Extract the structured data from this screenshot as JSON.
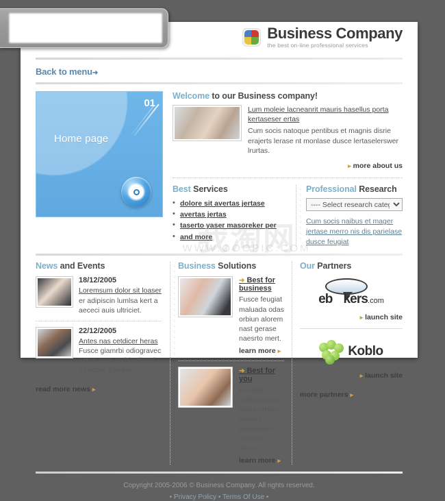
{
  "overlay": {
    "name": "blurred-panel"
  },
  "header": {
    "brand_name": "Business Company",
    "tagline": "the best on-line professional services",
    "back_label": "Back to menu",
    "back_arrow": "➜"
  },
  "hero": {
    "title": "Home page",
    "number": "01",
    "disc_icon": "target-disc-icon"
  },
  "welcome": {
    "title_hl": "Welcome",
    "title_rest": " to our Business company!",
    "thumb": "people-group-photo",
    "link": "Lum moleie lacneanrit mauris hasellus porta kertaseser ertas",
    "copy": "Cum socis natoque pentibus et magnis disrie erajerts lerase nt monlase dusce lertaselerswer lrurtas.",
    "more_label": "more about us",
    "bullet": "▸"
  },
  "services": {
    "title_hl": "Best",
    "title_rest": " Services",
    "items": [
      "dolore sit avertas jertase",
      "avertas jertas",
      "taserto yaser masoreker per",
      "and more"
    ]
  },
  "research": {
    "title_hl": "Professional",
    "title_rest": " Research",
    "select_value": "---- Select research category ----",
    "select_options": [
      "---- Select research category ----"
    ],
    "note": "Cum socis naibus et mager jertase merro nis dis parielase dusce feugiat"
  },
  "news": {
    "title_hl": "News",
    "title_rest": " and Events",
    "items": [
      {
        "date": "18/12/2005",
        "thumb": "handshake-photo",
        "link": "Loremsum dolor sit loaser",
        "copy": "er adipiscin lumlsa kert a aececi auis ultriciet."
      },
      {
        "date": "22/12/2005",
        "thumb": "business-pair-photo",
        "link": "Antes nas cetdicer heras",
        "copy": "Fusce giamrbi odiogravec uctus aore aorbi odioavi ec uctus a lorem."
      }
    ],
    "more_label": "read more news",
    "bullet": "▸"
  },
  "solutions": {
    "title_hl": "Business",
    "title_rest": " Solutions",
    "items": [
      {
        "thumb": "team-photo",
        "title": "Best for business",
        "copy": "Fusce feugiat maluada odas orbiun alorem nast gerase naesrto mert.",
        "more_label": "learn more"
      },
      {
        "thumb": "woman-portrait-photo",
        "title": "Best for you",
        "copy": "Feugiat maluada ioas lertsa orbiun alosert krteseryetr mertase dreos.",
        "more_label": "learn more"
      }
    ],
    "bullet": "➜",
    "more_bullet": "▸"
  },
  "partners": {
    "title_hl": "Our",
    "title_rest": " Partners",
    "items": [
      {
        "logo": "ebookers-logo",
        "name": "eb",
        "name2": "kers",
        "domain": ".com",
        "launch_label": "launch site"
      },
      {
        "logo": "koblo-logo",
        "name": "Koblo",
        "launch_label": "launch site"
      }
    ],
    "more_label": "more partners",
    "bullet": "▸"
  },
  "footer": {
    "copyright": "Copyright 2005-2006 © Business Company. All rights reserved.",
    "privacy": "Privacy Policy",
    "terms": "Terms Of Use",
    "dot": "•"
  },
  "watermark": {
    "line1": "我淘网",
    "line2": "WWW.OOOPIC.COM"
  },
  "colors": {
    "accent_blue": "#79b0cc",
    "hero_blue": "#6fb6e9",
    "link_gold": "#c8a24a",
    "page_bg": "#606060"
  }
}
